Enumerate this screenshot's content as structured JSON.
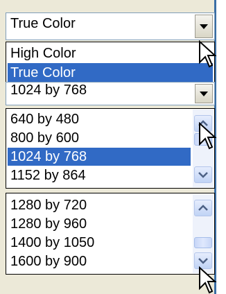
{
  "color_combo": {
    "value": "True Color"
  },
  "color_dropdown": {
    "items": [
      "High Color",
      "True Color"
    ],
    "selected": "True Color"
  },
  "resolution_combo": {
    "value": "1024 by 768"
  },
  "list1": {
    "items": [
      "640 by 480",
      "800 by 600",
      "1024 by 768",
      "1152 by 864"
    ],
    "selected": "1024 by 768"
  },
  "list2": {
    "items": [
      "1280 by 720",
      "1280 by 960",
      "1400 by 1050",
      "1600 by 900"
    ]
  },
  "icons": {
    "dropdown_arrow": "chevron-down-icon",
    "scroll_up": "chevron-up-icon",
    "scroll_down": "chevron-down-icon",
    "cursor": "mouse-pointer-icon"
  },
  "colors": {
    "selection": "#316ac5",
    "panel": "#ece9d8",
    "scrollbar": "#c0d3f5"
  }
}
